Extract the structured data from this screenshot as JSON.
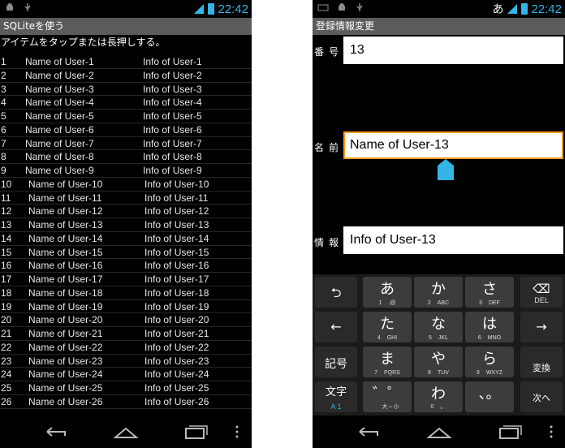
{
  "left_screen": {
    "status_time": "22:42",
    "title": "SQLiteを使う",
    "hint": "アイテムをタップまたは長押しする。",
    "rows": [
      {
        "id": "1",
        "name": "Name of User-1",
        "info": "Info of User-1"
      },
      {
        "id": "2",
        "name": "Name of User-2",
        "info": "Info of User-2"
      },
      {
        "id": "3",
        "name": "Name of User-3",
        "info": "Info of User-3"
      },
      {
        "id": "4",
        "name": "Name of User-4",
        "info": "Info of User-4"
      },
      {
        "id": "5",
        "name": "Name of User-5",
        "info": "Info of User-5"
      },
      {
        "id": "6",
        "name": "Name of User-6",
        "info": "Info of User-6"
      },
      {
        "id": "7",
        "name": "Name of User-7",
        "info": "Info of User-7"
      },
      {
        "id": "8",
        "name": "Name of User-8",
        "info": "Info of User-8"
      },
      {
        "id": "9",
        "name": "Name of User-9",
        "info": "Info of User-9"
      },
      {
        "id": "10",
        "name": "Name of User-10",
        "info": "Info of User-10"
      },
      {
        "id": "11",
        "name": "Name of User-11",
        "info": "Info of User-11"
      },
      {
        "id": "12",
        "name": "Name of User-12",
        "info": "Info of User-12"
      },
      {
        "id": "13",
        "name": "Name of User-13",
        "info": "Info of User-13"
      },
      {
        "id": "14",
        "name": "Name of User-14",
        "info": "Info of User-14"
      },
      {
        "id": "15",
        "name": "Name of User-15",
        "info": "Info of User-15"
      },
      {
        "id": "16",
        "name": "Name of User-16",
        "info": "Info of User-16"
      },
      {
        "id": "17",
        "name": "Name of User-17",
        "info": "Info of User-17"
      },
      {
        "id": "18",
        "name": "Name of User-18",
        "info": "Info of User-18"
      },
      {
        "id": "19",
        "name": "Name of User-19",
        "info": "Info of User-19"
      },
      {
        "id": "20",
        "name": "Name of User-20",
        "info": "Info of User-20"
      },
      {
        "id": "21",
        "name": "Name of User-21",
        "info": "Info of User-21"
      },
      {
        "id": "22",
        "name": "Name of User-22",
        "info": "Info of User-22"
      },
      {
        "id": "23",
        "name": "Name of User-23",
        "info": "Info of User-23"
      },
      {
        "id": "24",
        "name": "Name of User-24",
        "info": "Info of User-24"
      },
      {
        "id": "25",
        "name": "Name of User-25",
        "info": "Info of User-25"
      },
      {
        "id": "26",
        "name": "Name of User-26",
        "info": "Info of User-26"
      }
    ]
  },
  "right_screen": {
    "status_time": "22:42",
    "status_ime": "あ",
    "title": "登録情報変更",
    "fields": {
      "number_label": "番号",
      "number_value": "13",
      "name_label": "名前",
      "name_value": "Name of User-13",
      "info_label": "情報",
      "info_value": "Info of User-13"
    },
    "keyboard": {
      "undo": "⮌",
      "left_arrow": "←",
      "right_arrow": "→",
      "kigou": "記号",
      "moji": "文字",
      "moji_sub": "A 1",
      "del": "⌫",
      "del_label": "DEL",
      "henkan": "変換",
      "next": "次へ",
      "keys": [
        {
          "main": "あ",
          "num": "1",
          "letters": ".@"
        },
        {
          "main": "か",
          "num": "2",
          "letters": "ABC"
        },
        {
          "main": "さ",
          "num": "3",
          "letters": "DEF"
        },
        {
          "main": "た",
          "num": "4",
          "letters": "GHI"
        },
        {
          "main": "な",
          "num": "5",
          "letters": "JKL"
        },
        {
          "main": "は",
          "num": "6",
          "letters": "MNO"
        },
        {
          "main": "ま",
          "num": "7",
          "letters": "PQRS"
        },
        {
          "main": "や",
          "num": "8",
          "letters": "TUV"
        },
        {
          "main": "ら",
          "num": "9",
          "letters": "WXYZ"
        },
        {
          "main": "゛゜",
          "num": "",
          "letters": "大⇔小"
        },
        {
          "main": "わ",
          "num": "0",
          "letters": "。"
        },
        {
          "main": "、。",
          "num": "",
          "letters": ""
        }
      ]
    }
  },
  "colors": {
    "accent": "#33b5e5",
    "focus": "#ff9a1e",
    "title_bar": "#5b5b5b"
  }
}
